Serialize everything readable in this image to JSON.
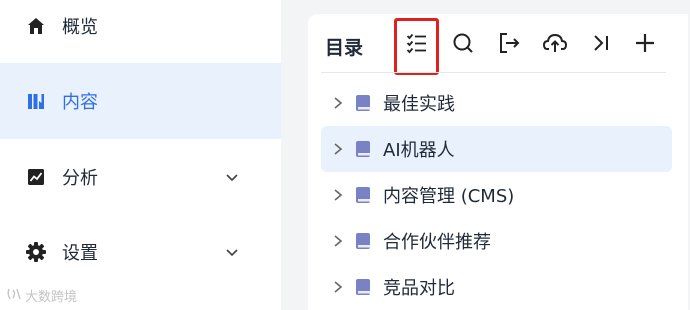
{
  "sidebar": {
    "items": [
      {
        "label": "概览",
        "icon": "home-icon",
        "active": false,
        "expandable": false
      },
      {
        "label": "内容",
        "icon": "content-icon",
        "active": true,
        "expandable": false
      },
      {
        "label": "分析",
        "icon": "chart-icon",
        "active": false,
        "expandable": true
      },
      {
        "label": "设置",
        "icon": "gear-icon",
        "active": false,
        "expandable": true
      }
    ]
  },
  "watermark": {
    "text": "大数跨境"
  },
  "panel": {
    "title": "目录",
    "toolbar": [
      {
        "icon": "checklist-icon",
        "highlighted": true
      },
      {
        "icon": "search-icon"
      },
      {
        "icon": "export-icon"
      },
      {
        "icon": "upload-icon"
      },
      {
        "icon": "collapse-icon"
      },
      {
        "icon": "add-icon"
      }
    ],
    "tree": [
      {
        "label": "最佳实践",
        "selected": false
      },
      {
        "label": "AI机器人",
        "selected": true
      },
      {
        "label": "内容管理 (CMS)",
        "selected": false
      },
      {
        "label": "合作伙伴推荐",
        "selected": false
      },
      {
        "label": "竞品对比",
        "selected": false
      }
    ]
  },
  "colors": {
    "accent": "#2f6fe4",
    "active_bg": "#e9f1fc",
    "highlight_border": "#e0201c",
    "book_icon": "#7a82c6"
  }
}
